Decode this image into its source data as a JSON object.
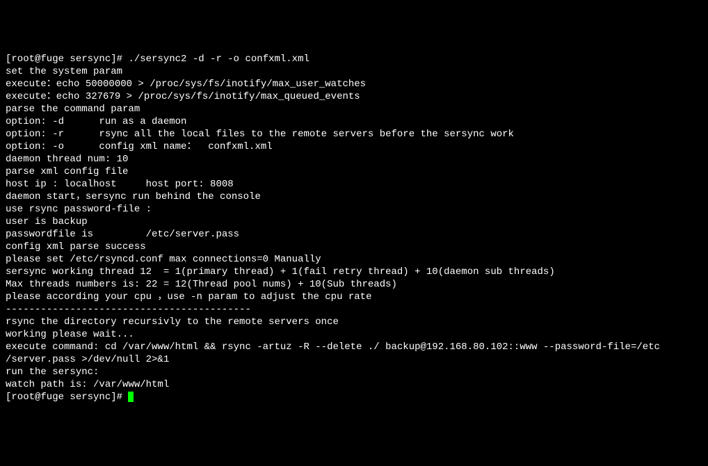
{
  "terminal": {
    "prompt": "[root@fuge sersync]# ",
    "command": "./sersync2 -d -r -o confxml.xml",
    "lines": [
      "set the system param",
      "execute：echo 50000000 > /proc/sys/fs/inotify/max_user_watches",
      "execute：echo 327679 > /proc/sys/fs/inotify/max_queued_events",
      "parse the command param",
      "option: -d      run as a daemon",
      "option: -r      rsync all the local files to the remote servers before the sersync work",
      "option: -o      config xml name：  confxml.xml",
      "daemon thread num: 10",
      "parse xml config file",
      "host ip : localhost     host port: 8008",
      "daemon start，sersync run behind the console ",
      "use rsync password-file :",
      "user is backup",
      "passwordfile is         /etc/server.pass",
      "config xml parse success",
      "please set /etc/rsyncd.conf max connections=0 Manually",
      "sersync working thread 12  = 1(primary thread) + 1(fail retry thread) + 10(daemon sub threads) ",
      "Max threads numbers is: 22 = 12(Thread pool nums) + 10(Sub threads)",
      "please according your cpu ，use -n param to adjust the cpu rate",
      "------------------------------------------",
      "rsync the directory recursivly to the remote servers once",
      "working please wait...",
      "execute command: cd /var/www/html && rsync -artuz -R --delete ./ backup@192.168.80.102::www --password-file=/etc",
      "/server.pass >/dev/null 2>&1 ",
      "run the sersync: ",
      "watch path is: /var/www/html"
    ],
    "end_prompt": "[root@fuge sersync]# "
  }
}
